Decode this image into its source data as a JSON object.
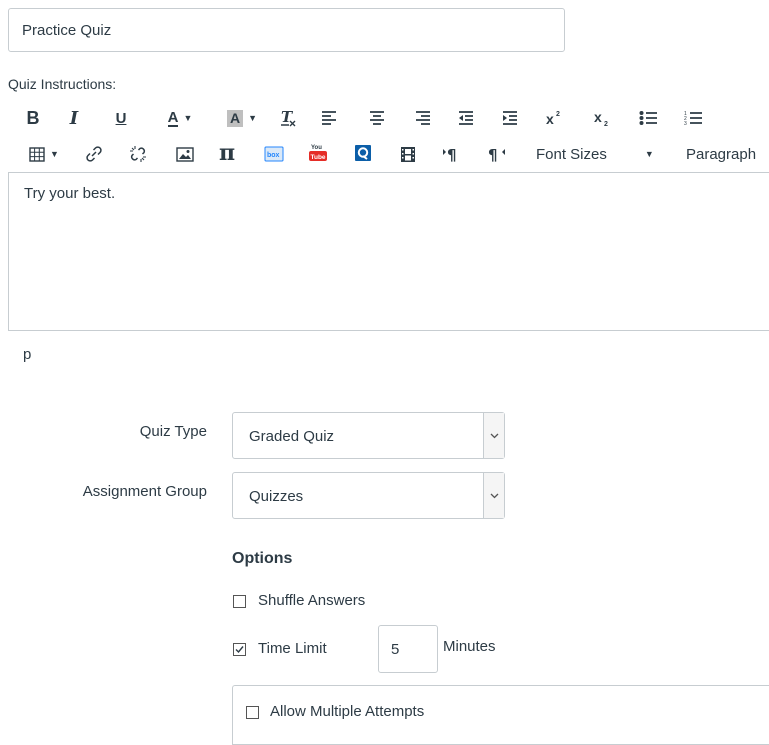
{
  "quiz": {
    "title_value": "Practice Quiz"
  },
  "instructions": {
    "label": "Quiz Instructions:",
    "content": "Try your best.",
    "path": "p"
  },
  "toolbar": {
    "bold": "B",
    "italic": "I",
    "underline": "U",
    "text_color": "A",
    "bg_color": "A",
    "font_sizes": "Font Sizes",
    "paragraph": "Paragraph",
    "icons": [
      "bold-icon",
      "italic-icon",
      "underline-icon",
      "text-color-icon",
      "background-color-icon",
      "clear-formatting-icon",
      "align-left-icon",
      "align-center-icon",
      "align-right-icon",
      "outdent-icon",
      "indent-icon",
      "superscript-icon",
      "subscript-icon",
      "bullet-list-icon",
      "numbered-list-icon",
      "table-icon",
      "link-icon",
      "unlink-icon",
      "image-icon",
      "math-equation-icon",
      "box-icon",
      "youtube-icon",
      "office-icon",
      "media-icon",
      "ltr-icon",
      "rtl-icon"
    ]
  },
  "form": {
    "quiz_type": {
      "label": "Quiz Type",
      "value": "Graded Quiz"
    },
    "assignment_group": {
      "label": "Assignment Group",
      "value": "Quizzes"
    }
  },
  "options": {
    "heading": "Options",
    "shuffle_answers": {
      "label": "Shuffle Answers",
      "checked": false
    },
    "time_limit": {
      "label": "Time Limit",
      "checked": true,
      "value": "5",
      "unit": "Minutes"
    },
    "multiple_attempts": {
      "label": "Allow Multiple Attempts",
      "checked": false
    }
  },
  "colors": {
    "text": "#2d3b45",
    "border": "#c7cdd1",
    "youtube_red": "#e52d27",
    "box_blue": "#2486fc",
    "office_blue": "#0b5ea8"
  }
}
